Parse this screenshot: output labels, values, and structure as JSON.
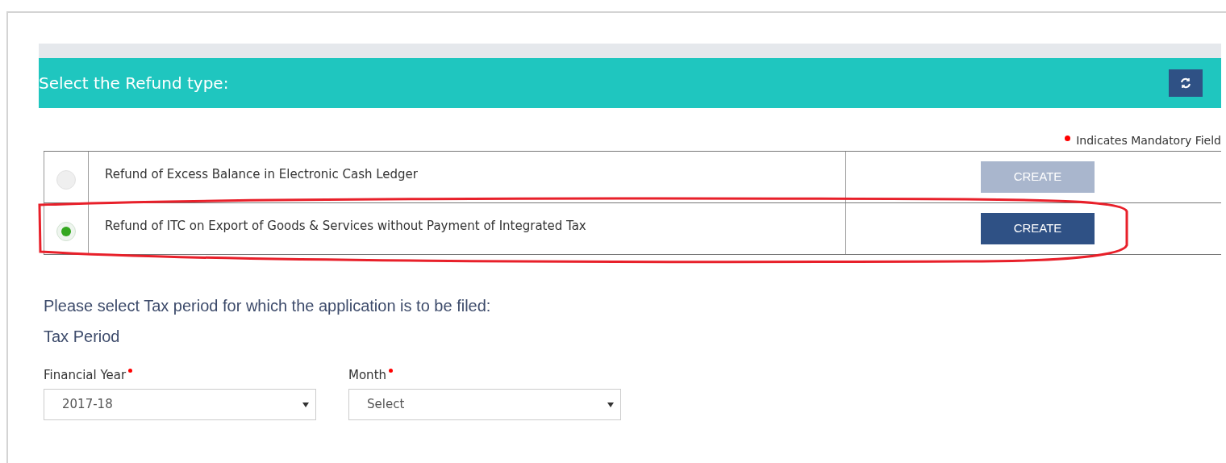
{
  "header": {
    "title": "Select the Refund type:"
  },
  "mandatory_note": "Indicates Mandatory Field",
  "refund_types": [
    {
      "label": "Refund of Excess Balance in Electronic Cash Ledger",
      "selected": false,
      "button": "CREATE",
      "disabled": true,
      "highlighted": false
    },
    {
      "label": "Refund of ITC on Export of Goods & Services without Payment of Integrated Tax",
      "selected": true,
      "button": "CREATE",
      "disabled": false,
      "highlighted": true
    }
  ],
  "prompt": "Please select Tax period for which the application is to be filed:",
  "section_title": "Tax Period",
  "fields": [
    {
      "label": "Financial Year",
      "required": true,
      "value": "2017-18"
    },
    {
      "label": "Month",
      "required": true,
      "value": "Select"
    }
  ]
}
